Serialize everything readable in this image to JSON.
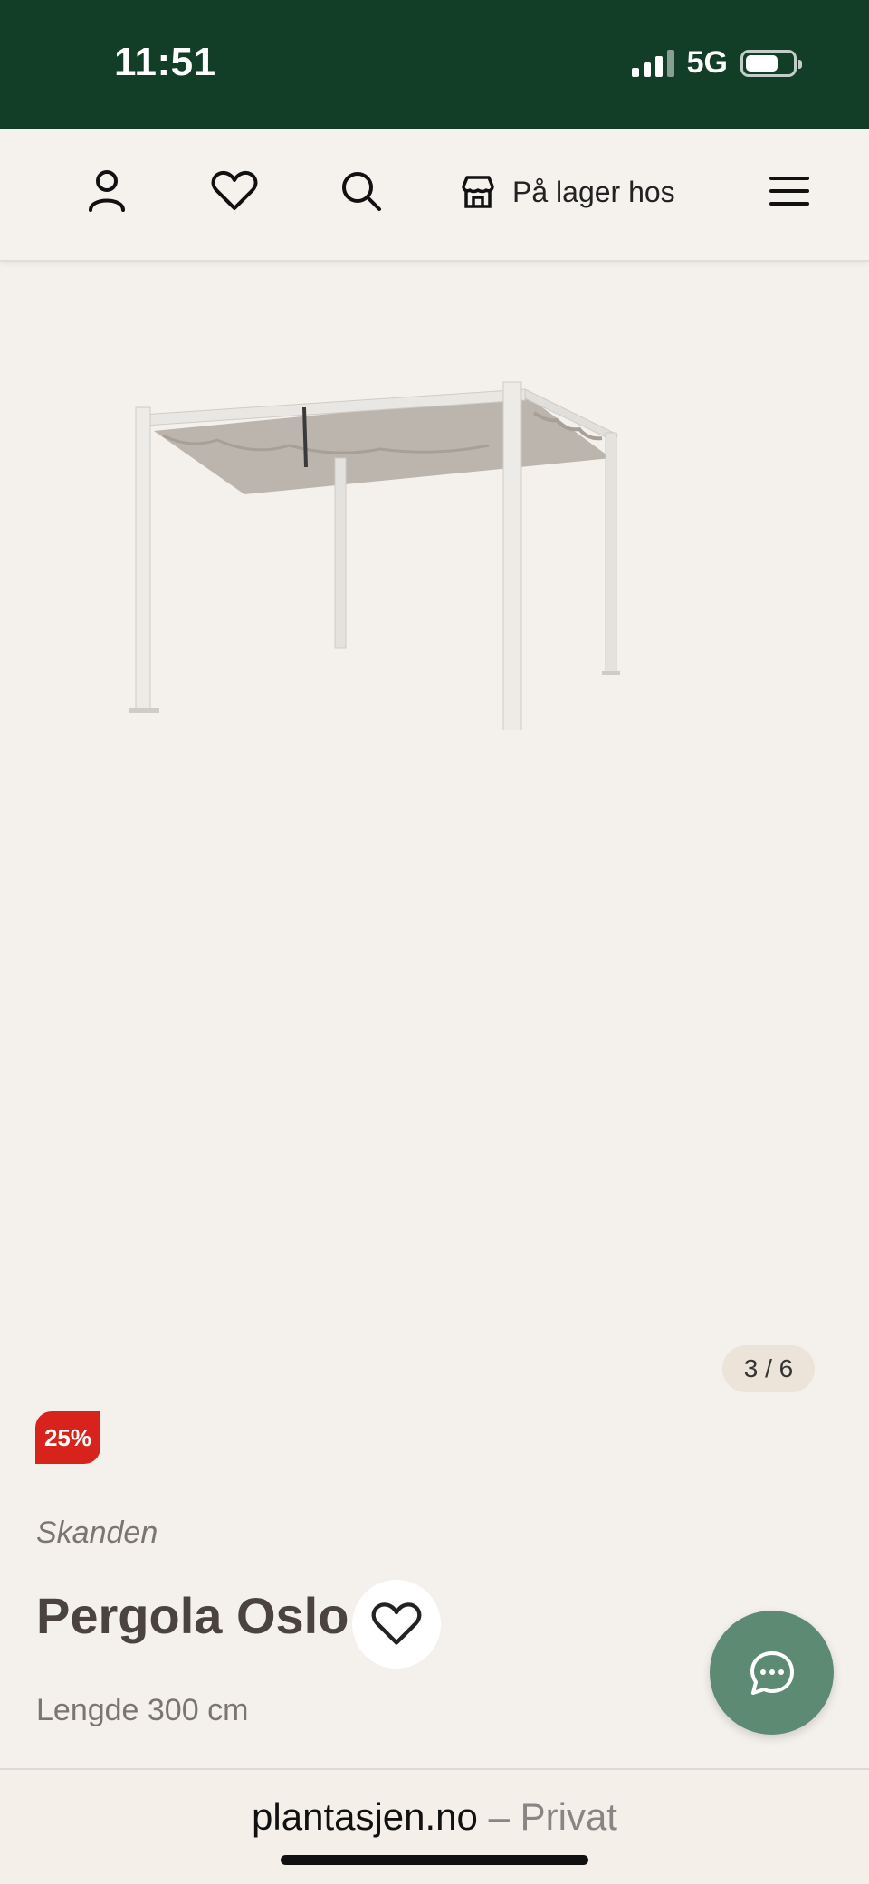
{
  "status": {
    "time": "11:51",
    "network": "5G"
  },
  "header": {
    "icons": [
      "user-icon",
      "heart-icon",
      "search-icon",
      "store-icon",
      "menu-icon"
    ],
    "store_label": "På lager hos"
  },
  "gallery": {
    "counter": "3 / 6"
  },
  "product": {
    "discount_badge": "25%",
    "brand": "Skanden",
    "title": "Pergola Oslo",
    "variant": "Lengde 300 cm"
  },
  "browser": {
    "domain": "plantasjen.no",
    "separator": "–",
    "mode": "Privat"
  },
  "colors": {
    "status_bar": "#123d26",
    "background": "#f4f0ec",
    "badge": "#d8231c",
    "chat_button": "#5c8a73"
  }
}
